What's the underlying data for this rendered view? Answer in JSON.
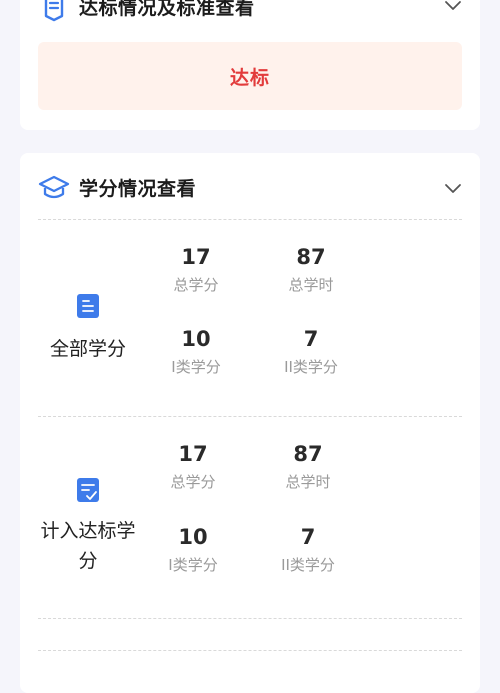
{
  "standard_section": {
    "title": "达标情况及标准查看",
    "icon": "document-icon",
    "status": "达标",
    "status_color": "#e23b3b",
    "status_bg": "#fff2ec"
  },
  "credit_section": {
    "title": "学分情况查看",
    "icon": "graduation-cap-icon",
    "blocks": [
      {
        "label": "全部学分",
        "icon": "list-document-icon",
        "stats": [
          {
            "value": "17",
            "label": "总学分"
          },
          {
            "value": "87",
            "label": "总学时"
          },
          {
            "value": "10",
            "label": "I类学分"
          },
          {
            "value": "7",
            "label": "II类学分"
          }
        ]
      },
      {
        "label": "计入达标学分",
        "icon": "checked-document-icon",
        "stats": [
          {
            "value": "17",
            "label": "总学分"
          },
          {
            "value": "87",
            "label": "总学时"
          },
          {
            "value": "10",
            "label": "I类学分"
          },
          {
            "value": "7",
            "label": "II类学分"
          }
        ]
      }
    ]
  },
  "accent_color": "#3e7bea"
}
